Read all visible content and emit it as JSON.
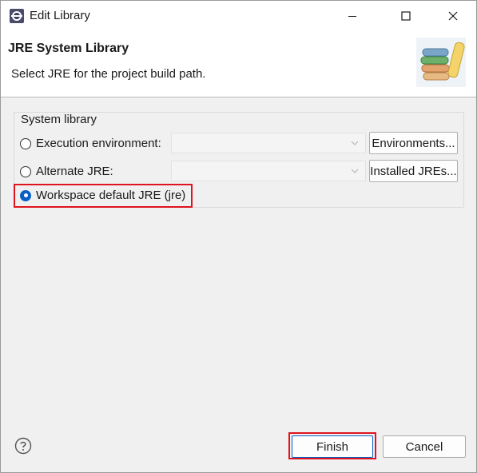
{
  "window": {
    "title": "Edit Library"
  },
  "header": {
    "title": "JRE System Library",
    "description": "Select JRE for the project build path."
  },
  "group": {
    "label": "System library",
    "options": [
      {
        "label": "Execution environment:",
        "selected": false,
        "combo_value": "",
        "button": "Environments..."
      },
      {
        "label": "Alternate JRE:",
        "selected": false,
        "combo_value": "",
        "button": "Installed JREs..."
      },
      {
        "label": "Workspace default JRE (jre)",
        "selected": true
      }
    ]
  },
  "footer": {
    "finish_label": "Finish",
    "cancel_label": "Cancel"
  },
  "colors": {
    "highlight": "#e0141e",
    "radio_selected": "#0a5fc4"
  },
  "icons": [
    "eclipse-app-icon",
    "minimize-icon",
    "maximize-icon",
    "close-icon",
    "books-icon",
    "chevron-down-icon",
    "help-icon"
  ]
}
